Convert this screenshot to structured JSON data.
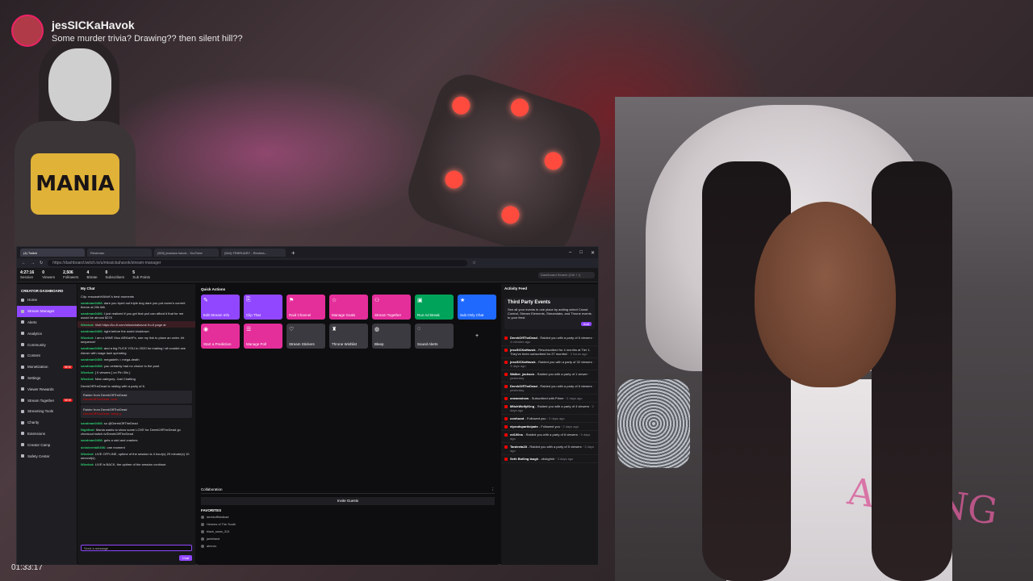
{
  "overlay": {
    "streamer_name": "jesSICKaHavok",
    "chat_message": "Some murder trivia? Drawing?? then silent hill??",
    "avatar_logo": "MANIA",
    "timer": "01:33:17",
    "shirt_text": "ATE NG"
  },
  "browser": {
    "tabs": [
      "(4) Twitch",
      "Restream",
      "(500) jessicka havok - YouTube",
      "(544) FEBRUARY - Restrea..."
    ],
    "new_tab": "+",
    "window_controls": [
      "–",
      "□",
      "✕"
    ],
    "url": "https://dashboard.twitch.tv/u/missickahavok/stream-manager"
  },
  "twitch": {
    "top_stats": [
      {
        "value": "4:27:16",
        "label": "Session"
      },
      {
        "value": "0",
        "label": "Viewers"
      },
      {
        "value": "2,506",
        "label": "Followers"
      },
      {
        "value": "4",
        "label": "Bitrate"
      },
      {
        "value": "0",
        "label": "Subscribers"
      },
      {
        "value": "5",
        "label": "Sub Points"
      }
    ],
    "search_placeholder": "Dashboard Search (Ctrl + /)"
  },
  "sidebar": {
    "header": "CREATOR DASHBOARD",
    "items": [
      {
        "label": "Home"
      },
      {
        "label": "Stream Manager",
        "active": true
      },
      {
        "label": "Alerts"
      },
      {
        "label": "Analytics"
      },
      {
        "label": "Community"
      },
      {
        "label": "Content"
      },
      {
        "label": "Monetization",
        "badge": "NEW"
      },
      {
        "label": "Settings"
      },
      {
        "label": "Viewer Rewards"
      },
      {
        "label": "Stream Together",
        "badge": "NEW"
      },
      {
        "label": "Streaming Tools"
      },
      {
        "label": "Charity"
      },
      {
        "label": "Extensions"
      },
      {
        "label": "Creator Camp"
      },
      {
        "label": "Safety Center"
      }
    ]
  },
  "chat": {
    "title": "My Chat",
    "pinned": "Clip: mssarahHAVoK's best moments",
    "messages": [
      {
        "user": "sandman0408:",
        "text": "dare you tryed out triple dog dare you put raven's current theme at 20k tiltk"
      },
      {
        "user": "sandman0408:",
        "text": "I just realized if you get that ps4 can afford it that for me would be almost $270"
      },
      {
        "user": "Wizebot:",
        "text": "Visit https://ko-fi.com/missickahavok Ko-fi page at",
        "highlight": true
      },
      {
        "user": "sandman0408:",
        "text": "right before the world shutdown"
      },
      {
        "user": "Wizebot:",
        "text": "I am a WWE Moo ARKiaHFs, see my link to place an order. hit sequence!"
      },
      {
        "user": "sandman0408:",
        "text": "and a big FUCK YOU to 2020 for making i sit couldnt see Alexer with mage lash spending"
      },
      {
        "user": "sandman0408:",
        "text": "megadeth = mega-death"
      },
      {
        "user": "sandman0408:",
        "text": "you certainly had no choice to the post"
      },
      {
        "user": "Wizebot:",
        "text": "[ 0 viewers ] on Pin 30s ]"
      },
      {
        "user": "Wizebot:",
        "text": "New category: Just Chatting"
      }
    ],
    "raid_line": "DerekOffTheDead is raiding with a party of 6.",
    "raid_cards": [
      {
        "title": "Raider from DerekOffTheDead",
        "line": "DerekOffTheDead: cool"
      },
      {
        "title": "Raider from DerekOffTheDead",
        "line": "DerekOffTheDead: sleep y"
      }
    ],
    "tail_messages": [
      {
        "user": "sandman0408:",
        "text": "so @DerekOffTheDead"
      },
      {
        "user": "Nightbot:",
        "text": "Mania wants to show some LOVE for DerekOffTheDead go checkout twitch.tv/DerekOffTheDead"
      },
      {
        "user": "sandman0408:",
        "text": "gets a raid and crashes"
      },
      {
        "user": "sinisteretal0406:",
        "text": "one moment"
      },
      {
        "user": "Wizebot:",
        "text": "LIVE OFFLINE, uptime of the session is 4 hour(s) 29 minute(s) 10 second(s)."
      },
      {
        "user": "Wizebot:",
        "text": "LIVE is BACK, the uptime of the session continue."
      }
    ],
    "input_placeholder": "Send a message",
    "points": "470",
    "send_label": "Chat"
  },
  "quick_actions": {
    "title": "Quick Actions",
    "tiles": [
      {
        "label": "Edit Stream Info",
        "color": "#9147ff",
        "icon": "✎"
      },
      {
        "label": "Clip That",
        "color": "#9147ff",
        "icon": "⎘"
      },
      {
        "label": "Raid Channel",
        "color": "#e42e9a",
        "icon": "⚑"
      },
      {
        "label": "Manage Goals",
        "color": "#e42e9a",
        "icon": "☆"
      },
      {
        "label": "Stream Together",
        "color": "#e42e9a",
        "icon": "⚇"
      },
      {
        "label": "Run Ad Break",
        "color": "#00a35a",
        "icon": "▣"
      },
      {
        "label": "Sub Only Chat",
        "color": "#1f69ff",
        "icon": "★"
      },
      {
        "label": "Start a Prediction",
        "color": "#e42e9a",
        "icon": "◉"
      },
      {
        "label": "Manage Poll",
        "color": "#e42e9a",
        "icon": "☰"
      },
      {
        "label": "Stream Stickers",
        "color": "#3a3a40",
        "icon": "♡"
      },
      {
        "label": "Throne Wishlist",
        "color": "#3a3a40",
        "icon": "♜"
      },
      {
        "label": "Bleep",
        "color": "#3a3a40",
        "icon": "◍"
      },
      {
        "label": "Sound Alerts",
        "color": "#3a3a40",
        "icon": "◌"
      },
      {
        "label": "",
        "color": "#0e0e10",
        "icon": "+"
      }
    ]
  },
  "collaboration": {
    "title": "Collaboration",
    "invite_label": "Invite Guests",
    "favorites_title": "FAVORITES",
    "friends": [
      "derekoffthedead",
      "Hermes of The South",
      "black_swan_313",
      "jamieland",
      "ahnnxx"
    ]
  },
  "activity": {
    "title": "Activity Feed",
    "third_party": {
      "title": "Third Party Events",
      "text": "See all your events in one place by adding select Crowd Control, Stream Elements, Streamlabs, and Throne events to your feed.",
      "button": "Add"
    },
    "events": [
      {
        "who": "DerekOffTheDead",
        "what": "Raided you with a party of 6 viewers",
        "when": "4 minutes ago"
      },
      {
        "who": "jessSICKaHavok",
        "what": "Resubscribed for 4 months at Tier 1. They've been subscribed for 27 months!",
        "when": "2 hours ago"
      },
      {
        "who": "jessSICKaHavok",
        "what": "Raided you with a party of 32 viewers",
        "when": "3 days ago"
      },
      {
        "who": "Walker_jackson",
        "what": "Raided you with a party of 1 viewer",
        "when": "yesterday"
      },
      {
        "who": "DerekOffTheDead",
        "what": "Raided you with a party of 6 viewers",
        "when": "yesterday"
      },
      {
        "who": "oneamshow",
        "what": "Subscribed with Prime",
        "when": "2 days ago"
      },
      {
        "who": "MitchWolfyKing",
        "what": "Raided you with a party of 4 viewers",
        "when": "2 days ago"
      },
      {
        "who": "confuzzd",
        "what": "Followed you",
        "when": "2 days ago"
      },
      {
        "who": "elprodsparticipate",
        "what": "Followed you",
        "when": "2 days ago"
      },
      {
        "who": "ed100ns",
        "what": "Raided you with a party of 6 viewers",
        "when": "3 days ago"
      },
      {
        "who": "Tardeeta28",
        "what": "Raided you with a party of 5 viewers",
        "when": "3 days ago"
      },
      {
        "who": "Seth Bolling laugh",
        "what": "clickgrhkl",
        "when": "3 days ago"
      }
    ]
  }
}
